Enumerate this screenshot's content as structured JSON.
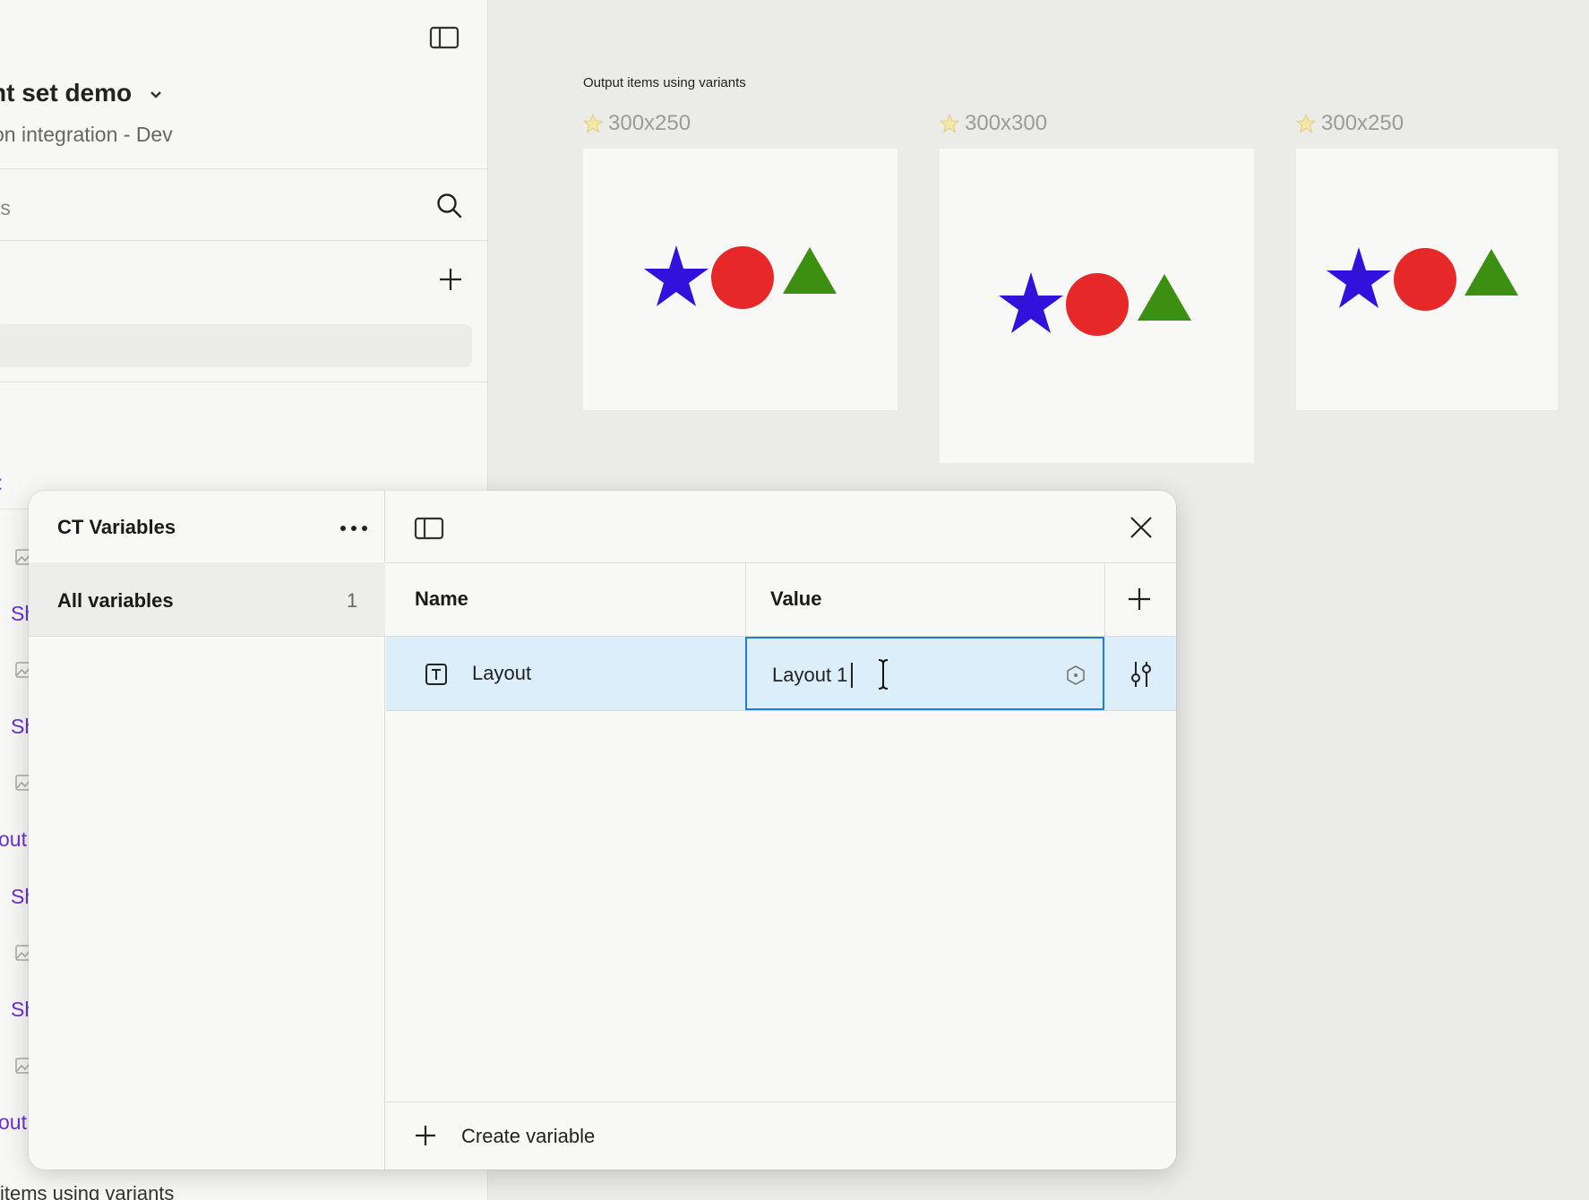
{
  "sidebar": {
    "title": "nt set demo",
    "subtitle": "on integration - Dev",
    "search_text": "ts",
    "purple_top": "t",
    "items": [
      "Sh",
      "Sh",
      "out",
      "Sh",
      "Sh",
      "out"
    ],
    "bottom_text": "items using variants"
  },
  "canvas": {
    "caption": "Output items using variants",
    "frames": [
      {
        "label": "300x250"
      },
      {
        "label": "300x300"
      },
      {
        "label": "300x250"
      }
    ],
    "shape_colors": {
      "star": "#3311dd",
      "circle": "#e62828",
      "triangle": "#3d8f12"
    }
  },
  "panel": {
    "title": "CT Variables",
    "all_variables_label": "All variables",
    "all_variables_count": "1",
    "columns": {
      "name": "Name",
      "value": "Value"
    },
    "rows": [
      {
        "type_icon": "text-type-icon",
        "name": "Layout",
        "value": "Layout 1"
      }
    ],
    "create_label": "Create variable",
    "accent": "#1f7de0",
    "selected_row_bg": "#ddeefb"
  }
}
